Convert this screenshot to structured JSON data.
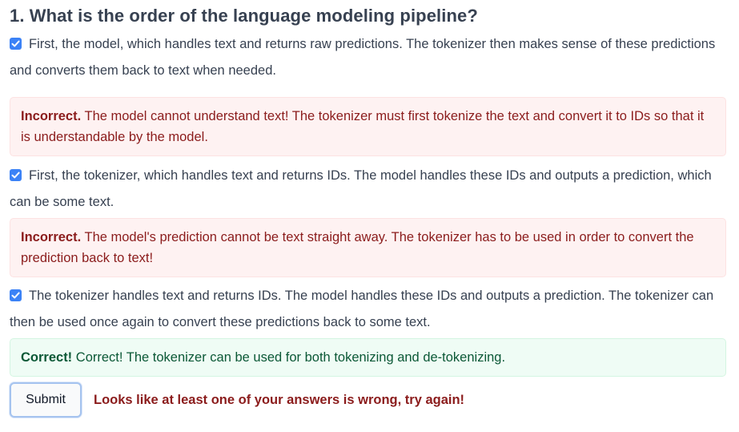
{
  "question": {
    "title": "1. What is the order of the language modeling pipeline?"
  },
  "options": [
    {
      "checked": true,
      "text": "First, the model, which handles text and returns raw predictions. The tokenizer then makes sense of these predictions and converts them back to text when needed.",
      "feedback": {
        "status": "incorrect",
        "verdict": "Incorrect.",
        "message": "The model cannot understand text! The tokenizer must first tokenize the text and convert it to IDs so that it is understandable by the model."
      }
    },
    {
      "checked": true,
      "text": "First, the tokenizer, which handles text and returns IDs. The model handles these IDs and outputs a prediction, which can be some text.",
      "feedback": {
        "status": "incorrect",
        "verdict": "Incorrect.",
        "message": "The model's prediction cannot be text straight away. The tokenizer has to be used in order to convert the prediction back to text!"
      }
    },
    {
      "checked": true,
      "text": "The tokenizer handles text and returns IDs. The model handles these IDs and outputs a prediction. The tokenizer can then be used once again to convert these predictions back to some text.",
      "feedback": {
        "status": "correct",
        "verdict": "Correct!",
        "message": "Correct! The tokenizer can be used for both tokenizing and de-tokenizing."
      }
    }
  ],
  "submit": {
    "label": "Submit"
  },
  "result": {
    "message": "Looks like at least one of your answers is wrong, try again!"
  },
  "colors": {
    "checkbox": "#3b82f6",
    "incorrect_bg": "#fef2f2",
    "incorrect_text": "#8b1c1c",
    "correct_bg": "#effcf5",
    "correct_text": "#0b5836"
  },
  "icons": {
    "checkbox": "checkmark-icon"
  }
}
